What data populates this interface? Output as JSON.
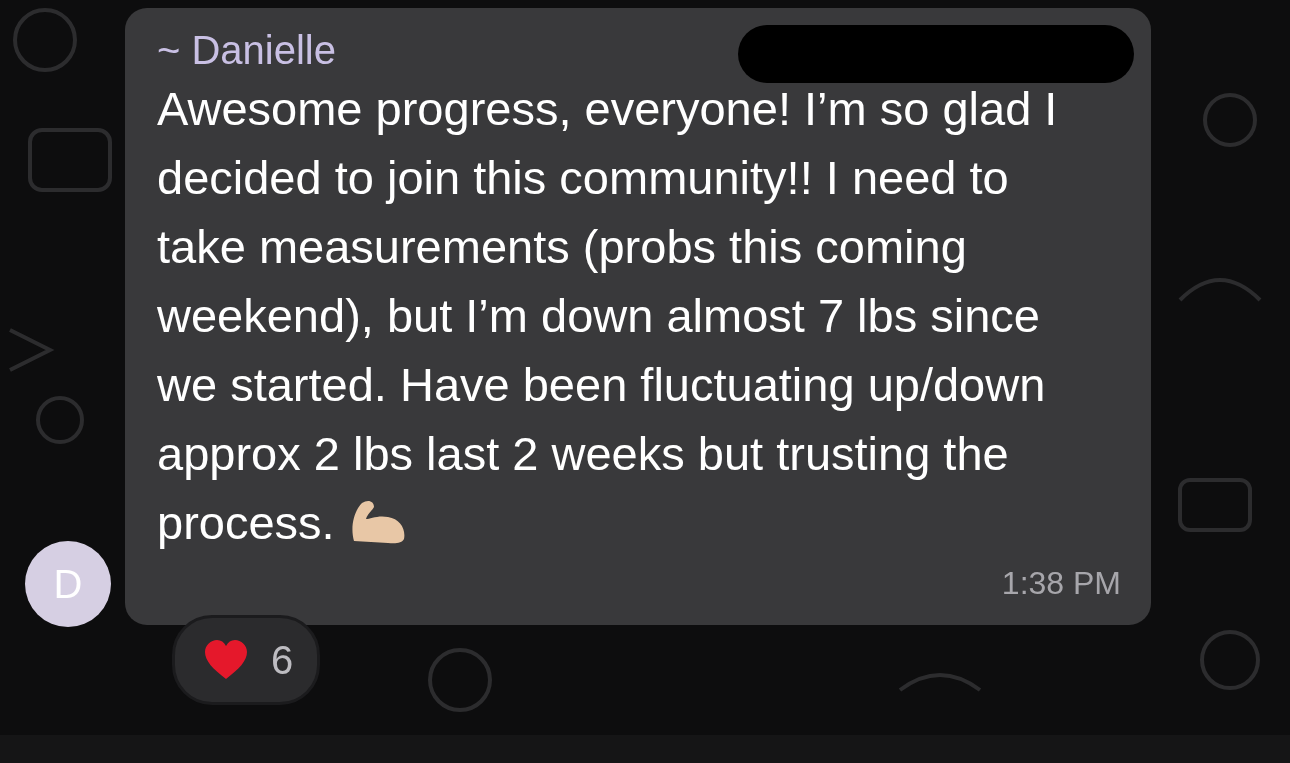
{
  "message": {
    "sender": "~ Danielle",
    "text": "Awesome progress, everyone! I’m so glad I decided to join this community!! I need to take measurements (probs this coming weekend), but I’m down almost 7 lbs since we started. Have been fluctuating up/down approx 2 lbs last 2 weeks but trusting the process.",
    "time": "1:38 PM",
    "avatar_letter": "D"
  },
  "reactions": [
    {
      "count": "6"
    }
  ]
}
